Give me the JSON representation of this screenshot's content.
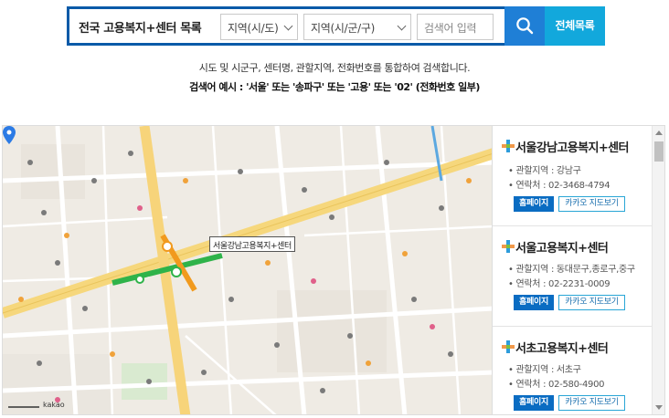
{
  "search": {
    "title": "전국 고용복지+센터 목록",
    "select1": "지역(시/도)",
    "select2": "지역(시/군/구)",
    "input_placeholder": "검색어 입력",
    "all_list_label": "전체목록"
  },
  "description": {
    "line1": "시도 및 시군구, 센터명, 관할지역, 전화번호를 통합하여 검색합니다.",
    "line2": "검색어 예시 : '서울' 또는 '송파구' 또는 '고용' 또는 '02' (전화번호 일부)"
  },
  "map": {
    "marker_label": "서울강남고용복지+센터",
    "scale_label": "kakao"
  },
  "centers": [
    {
      "name": "서울강남고용복지+센터",
      "area": "관할지역 : 강남구",
      "phone": "연락처 : 02-3468-4794",
      "home_label": "홈페이지",
      "kakao_label": "카카오 지도보기"
    },
    {
      "name": "서울고용복지+센터",
      "area": "관할지역 : 동대문구,종로구,중구",
      "phone": "연락처 : 02-2231-0009",
      "home_label": "홈페이지",
      "kakao_label": "카카오 지도보기"
    },
    {
      "name": "서초고용복지+센터",
      "area": "관할지역 : 서초구",
      "phone": "연락처 : 02-580-4900",
      "home_label": "홈페이지",
      "kakao_label": "카카오 지도보기"
    }
  ],
  "colors": {
    "brand_blue": "#0a5aa8",
    "search_button": "#1f7fd6",
    "all_button": "#12a8dc",
    "home_button": "#0a6cc2"
  },
  "icons": {
    "search": "search-icon",
    "cross": "welfare-cross-icon",
    "pin": "map-pin-icon"
  }
}
